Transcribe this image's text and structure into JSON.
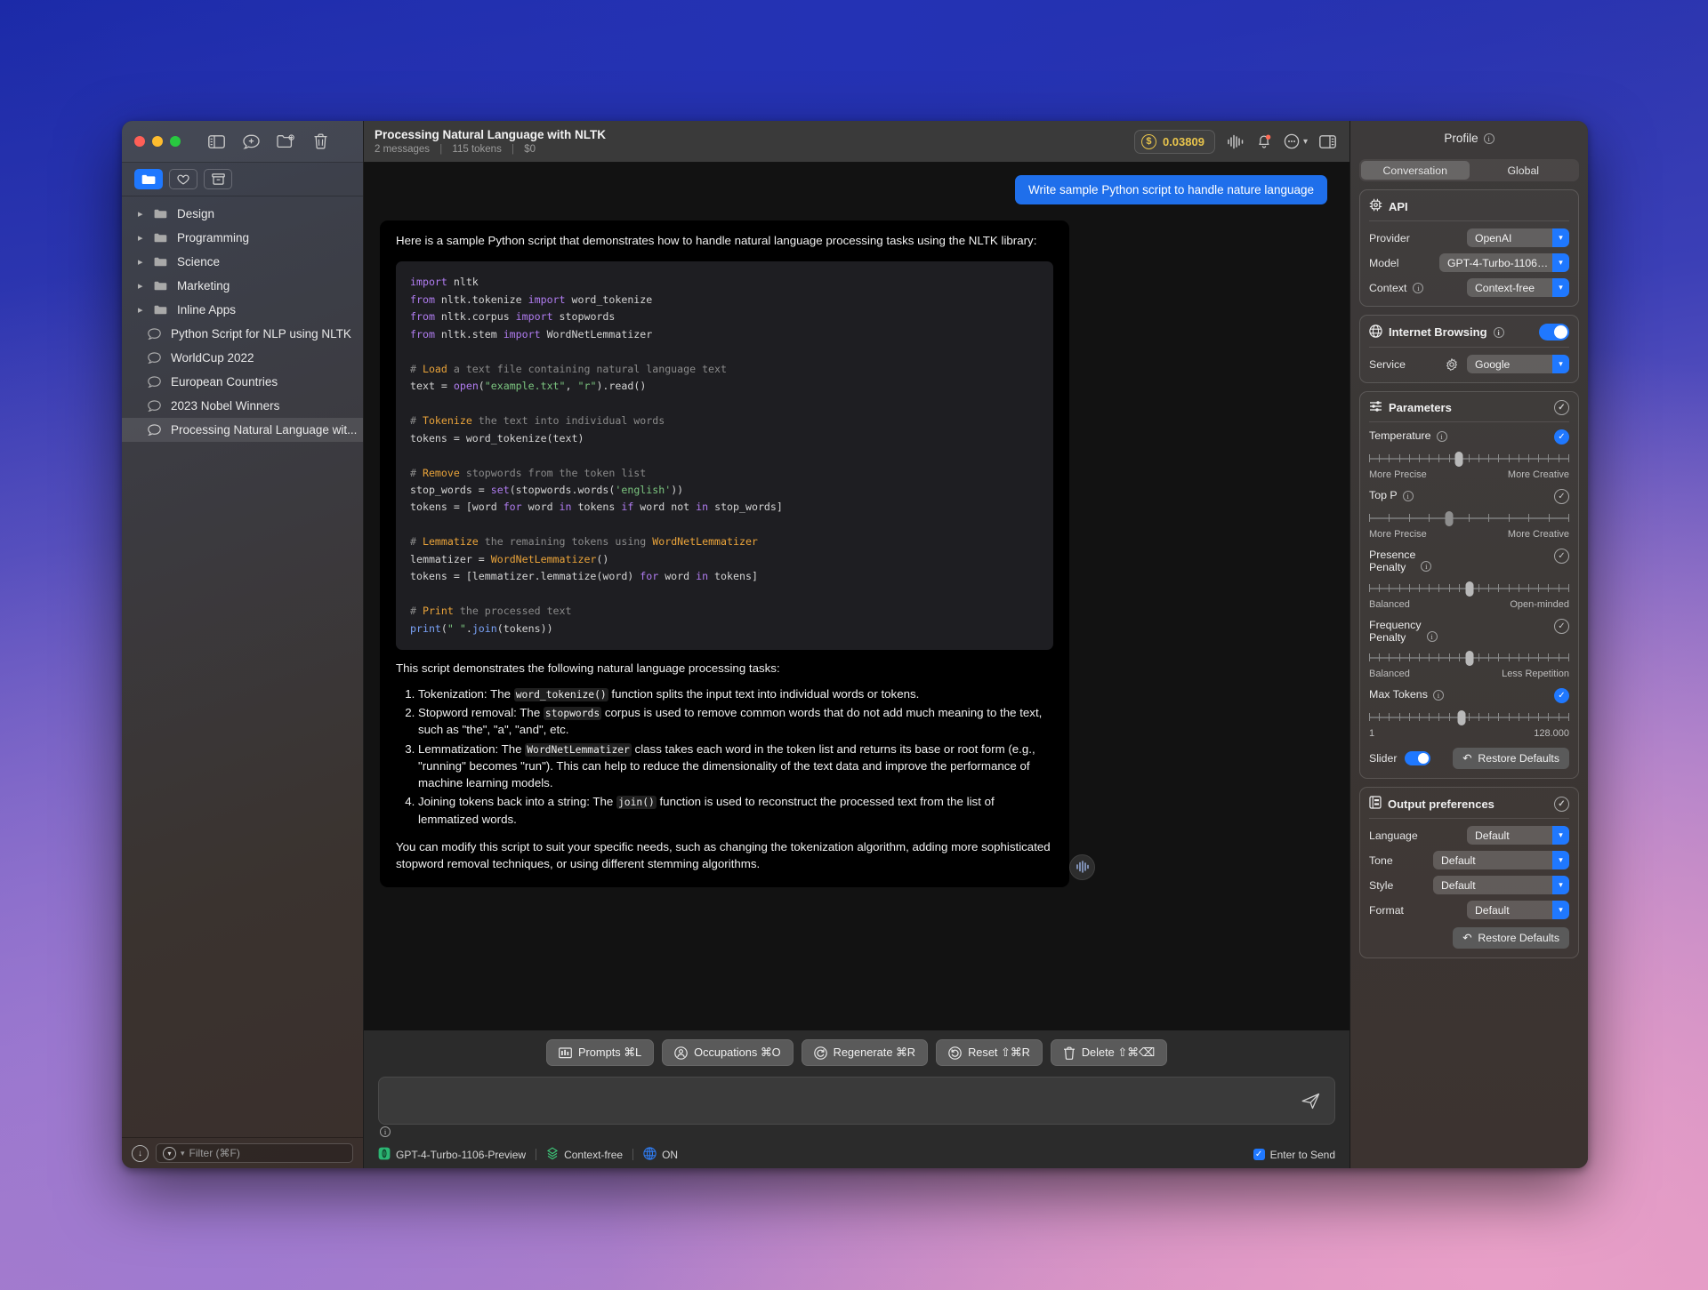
{
  "window": {
    "traffic_lights": [
      "close",
      "minimize",
      "zoom"
    ],
    "toolbar_icons": [
      "sidebar-toggle-icon",
      "new-chat-icon",
      "new-folder-icon",
      "trash-icon"
    ],
    "subbar_icons": [
      "folder-icon",
      "favorites-icon",
      "archive-icon"
    ]
  },
  "sidebar": {
    "items": [
      {
        "label": "Design",
        "type": "folder"
      },
      {
        "label": "Programming",
        "type": "folder"
      },
      {
        "label": "Science",
        "type": "folder"
      },
      {
        "label": "Marketing",
        "type": "folder"
      },
      {
        "label": "Inline Apps",
        "type": "folder"
      },
      {
        "label": "Python Script for NLP using NLTK",
        "type": "chat"
      },
      {
        "label": "WorldCup 2022",
        "type": "chat"
      },
      {
        "label": "European Countries",
        "type": "chat"
      },
      {
        "label": "2023 Nobel Winners",
        "type": "chat"
      },
      {
        "label": "Processing Natural Language wit...",
        "type": "chat",
        "selected": true
      }
    ],
    "footer": {
      "filter_placeholder": "Filter (⌘F)",
      "download_icon": "download-icon",
      "filter_menu_icon": "filter-menu-icon"
    }
  },
  "header": {
    "title": "Processing Natural Language with NLTK",
    "messages": "2 messages",
    "tokens": "115 tokens",
    "cost": "$0",
    "balance": "0.03809",
    "balance_color": "#e8c44c",
    "icons": [
      "waveform-icon",
      "bell-icon",
      "more-options-icon",
      "chevron-down-icon",
      "inspector-toggle-icon"
    ]
  },
  "conversation": {
    "user_message": "Write sample Python script to handle nature language",
    "assistant": {
      "intro": "Here is a sample Python script that demonstrates how to handle natural language processing tasks using the NLTK library:",
      "code_lines": [
        [
          {
            "t": "import",
            "c": "k"
          },
          {
            "t": " nltk",
            "c": ""
          }
        ],
        [
          {
            "t": "from",
            "c": "k"
          },
          {
            "t": " nltk.tokenize ",
            "c": ""
          },
          {
            "t": "import",
            "c": "k"
          },
          {
            "t": " word_tokenize",
            "c": ""
          }
        ],
        [
          {
            "t": "from",
            "c": "k"
          },
          {
            "t": " nltk.corpus ",
            "c": ""
          },
          {
            "t": "import",
            "c": "k"
          },
          {
            "t": " stopwords",
            "c": ""
          }
        ],
        [
          {
            "t": "from",
            "c": "k"
          },
          {
            "t": " nltk.stem ",
            "c": ""
          },
          {
            "t": "import",
            "c": "k"
          },
          {
            "t": " WordNetLemmatizer",
            "c": ""
          }
        ],
        [],
        [
          {
            "t": "# ",
            "c": "cm"
          },
          {
            "t": "Load",
            "c": "cmh"
          },
          {
            "t": " a text file containing natural language text",
            "c": "cm"
          }
        ],
        [
          {
            "t": "text = ",
            "c": ""
          },
          {
            "t": "open",
            "c": "k"
          },
          {
            "t": "(",
            "c": ""
          },
          {
            "t": "\"example.txt\"",
            "c": "st"
          },
          {
            "t": ", ",
            "c": ""
          },
          {
            "t": "\"r\"",
            "c": "st"
          },
          {
            "t": ").read()",
            "c": ""
          }
        ],
        [],
        [
          {
            "t": "# ",
            "c": "cm"
          },
          {
            "t": "Tokenize",
            "c": "cmh"
          },
          {
            "t": " the text into individual words",
            "c": "cm"
          }
        ],
        [
          {
            "t": "tokens = word_tokenize(text)",
            "c": ""
          }
        ],
        [],
        [
          {
            "t": "# ",
            "c": "cm"
          },
          {
            "t": "Remove",
            "c": "cmh"
          },
          {
            "t": " stopwords from the token list",
            "c": "cm"
          }
        ],
        [
          {
            "t": "stop_words = ",
            "c": ""
          },
          {
            "t": "set",
            "c": "k"
          },
          {
            "t": "(stopwords.words(",
            "c": ""
          },
          {
            "t": "'english'",
            "c": "st"
          },
          {
            "t": "))",
            "c": ""
          }
        ],
        [
          {
            "t": "tokens = [word ",
            "c": ""
          },
          {
            "t": "for",
            "c": "k"
          },
          {
            "t": " word ",
            "c": ""
          },
          {
            "t": "in",
            "c": "k"
          },
          {
            "t": " tokens ",
            "c": ""
          },
          {
            "t": "if",
            "c": "k"
          },
          {
            "t": " word not ",
            "c": ""
          },
          {
            "t": "in",
            "c": "k"
          },
          {
            "t": " stop_words]",
            "c": ""
          }
        ],
        [],
        [
          {
            "t": "# ",
            "c": "cm"
          },
          {
            "t": "Lemmatize",
            "c": "cmh"
          },
          {
            "t": " the remaining tokens using ",
            "c": "cm"
          },
          {
            "t": "WordNetLemmatizer",
            "c": "cls"
          }
        ],
        [
          {
            "t": "lemmatizer = ",
            "c": ""
          },
          {
            "t": "WordNetLemmatizer",
            "c": "cls"
          },
          {
            "t": "()",
            "c": ""
          }
        ],
        [
          {
            "t": "tokens = [lemmatizer.lemmatize(word) ",
            "c": ""
          },
          {
            "t": "for",
            "c": "k"
          },
          {
            "t": " word ",
            "c": ""
          },
          {
            "t": "in",
            "c": "k"
          },
          {
            "t": " tokens]",
            "c": ""
          }
        ],
        [],
        [
          {
            "t": "# ",
            "c": "cm"
          },
          {
            "t": "Print",
            "c": "cmh"
          },
          {
            "t": " the processed text",
            "c": "cm"
          }
        ],
        [
          {
            "t": "print",
            "c": "fn"
          },
          {
            "t": "(",
            "c": ""
          },
          {
            "t": "\" \"",
            "c": "st"
          },
          {
            "t": ".",
            "c": ""
          },
          {
            "t": "join",
            "c": "fn"
          },
          {
            "t": "(tokens))",
            "c": ""
          }
        ]
      ],
      "list_intro": "This script demonstrates the following natural language processing tasks:",
      "tasks": [
        [
          {
            "t": "Tokenization: The "
          },
          {
            "t": "word_tokenize()",
            "code": true
          },
          {
            "t": " function splits the input text into individual words or tokens."
          }
        ],
        [
          {
            "t": "Stopword removal: The "
          },
          {
            "t": "stopwords",
            "code": true
          },
          {
            "t": " corpus is used to remove common words that do not add much meaning to the text, such as \"the\", \"a\", \"and\", etc."
          }
        ],
        [
          {
            "t": "Lemmatization: The "
          },
          {
            "t": "WordNetLemmatizer",
            "code": true
          },
          {
            "t": " class takes each word in the token list and returns its base or root form (e.g., \"running\" becomes \"run\"). This can help to reduce the dimensionality of the text data and improve the performance of machine learning models."
          }
        ],
        [
          {
            "t": "Joining tokens back into a string: The "
          },
          {
            "t": "join()",
            "code": true
          },
          {
            "t": " function is used to reconstruct the processed text from the list of lemmatized words."
          }
        ]
      ],
      "closing": "You can modify this script to suit your specific needs, such as changing the tokenization algorithm, adding more sophisticated stopword removal techniques, or using different stemming algorithms."
    }
  },
  "action_bar": [
    {
      "label": "Prompts ⌘L",
      "icon": "prompts-icon"
    },
    {
      "label": "Occupations ⌘O",
      "icon": "occupations-icon"
    },
    {
      "label": "Regenerate ⌘R",
      "icon": "regenerate-icon"
    },
    {
      "label": "Reset ⇧⌘R",
      "icon": "reset-icon"
    },
    {
      "label": "Delete ⇧⌘⌫",
      "icon": "delete-icon"
    }
  ],
  "composer": {
    "placeholder": "",
    "send_icon": "send-icon",
    "info_icon": "info-icon"
  },
  "status_bar": {
    "model": "GPT-4-Turbo-1106-Preview",
    "context": "Context-free",
    "browsing": "ON",
    "enter_to_send": "Enter to Send",
    "enter_to_send_checked": true
  },
  "inspector": {
    "profile_title": "Profile",
    "scope_tabs": [
      {
        "label": "Conversation",
        "selected": true
      },
      {
        "label": "Global",
        "selected": false
      }
    ],
    "api": {
      "title": "API",
      "icon": "chip-icon",
      "rows": [
        {
          "label": "Provider",
          "value": "OpenAI",
          "info": false
        },
        {
          "label": "Model",
          "value": "GPT-4-Turbo-1106-...",
          "info": false
        },
        {
          "label": "Context",
          "value": "Context-free",
          "info": true
        }
      ]
    },
    "internet": {
      "title": "Internet Browsing",
      "icon": "globe-icon",
      "enabled": true,
      "service_label": "Service",
      "service_value": "Google",
      "service_icon": "gear-icon"
    },
    "parameters": {
      "title": "Parameters",
      "icon": "sliders-icon",
      "items": [
        {
          "label": "Temperature",
          "enabled": true,
          "pos": 45,
          "left": "More Precise",
          "right": "More Creative"
        },
        {
          "label": "Top P",
          "enabled": false,
          "pos": 40,
          "left": "More Precise",
          "right": "More Creative"
        },
        {
          "label": "Presence\nPenalty",
          "enabled": false,
          "pos": 50,
          "left": "Balanced",
          "right": "Open-minded"
        },
        {
          "label": "Frequency\nPenalty",
          "enabled": false,
          "pos": 50,
          "left": "Balanced",
          "right": "Less Repetition"
        },
        {
          "label": "Max Tokens",
          "enabled": true,
          "pos": 46,
          "left": "1",
          "right": "128.000"
        }
      ],
      "slider_label": "Slider",
      "slider_on": true,
      "restore_label": "Restore Defaults"
    },
    "output": {
      "title": "Output preferences",
      "icon": "output-icon",
      "rows": [
        {
          "label": "Language",
          "value": "Default"
        },
        {
          "label": "Tone",
          "value": "Default"
        },
        {
          "label": "Style",
          "value": "Default"
        },
        {
          "label": "Format",
          "value": "Default"
        }
      ],
      "restore_label": "Restore Defaults"
    }
  }
}
